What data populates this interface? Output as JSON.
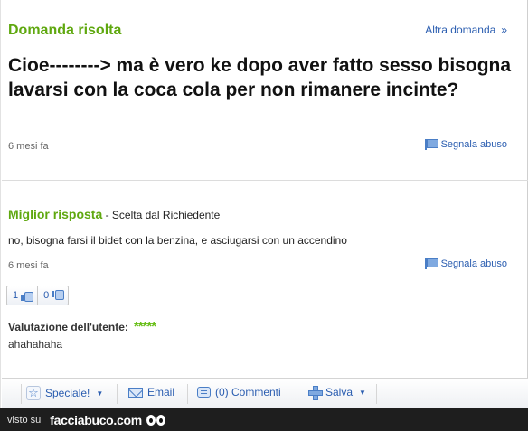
{
  "question": {
    "status_label": "Domanda risolta",
    "other_question_label": "Altra domanda",
    "other_question_chevron": "»",
    "title": "Cioe--------> ma è vero ke dopo aver fatto sesso bisogna lavarsi con la coca cola per non rimanere incinte?",
    "time_ago": "6 mesi fa",
    "report_label": "Segnala abuso"
  },
  "answer": {
    "label": "Miglior risposta",
    "chosen_by": " - Scelta dal Richiedente",
    "text": "no, bisogna farsi il bidet con la benzina, e asciugarsi con un accendino",
    "time_ago": "6 mesi fa",
    "report_label": "Segnala abuso",
    "thumbs_up_count": "1",
    "thumbs_down_count": "0",
    "rating_label": "Valutazione dell'utente:",
    "rating_stars": "*****",
    "rating_value": 5,
    "rating_max": 5,
    "user_comment": "ahahahaha"
  },
  "toolbar": {
    "special_label": "Speciale!",
    "email_label": "Email",
    "comments_label": "(0) Commenti",
    "save_label": "Salva",
    "caret": "▼"
  },
  "watermark": {
    "prefix": "visto su",
    "brand": "facciabuco.com"
  },
  "colors": {
    "accent_green": "#5fa80f",
    "link_blue": "#2a5db0",
    "star_green": "#6abf1a"
  }
}
